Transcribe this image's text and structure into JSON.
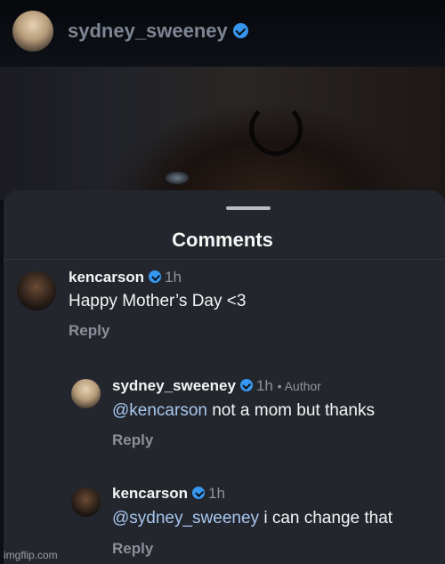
{
  "header": {
    "username": "sydney_sweeney",
    "verified_icon": "verified-badge-icon"
  },
  "comments_sheet": {
    "title": "Comments",
    "comments": [
      {
        "username": "kencarson",
        "time": "1h",
        "text": "Happy Mother’s Day <3",
        "reply_label": "Reply"
      }
    ],
    "replies": [
      {
        "username": "sydney_sweeney",
        "time": "1h",
        "author_tag": "• Author",
        "mention": "@kencarson",
        "text": " not a mom but thanks",
        "reply_label": "Reply"
      },
      {
        "username": "kencarson",
        "time": "1h",
        "mention": "@sydney_sweeney",
        "text": " i can change that",
        "reply_label": "Reply"
      }
    ]
  },
  "watermark": "imgflip.com",
  "colors": {
    "verified": "#3797f0",
    "mention": "#a8c7ee",
    "sheet_bg": "#23262d"
  }
}
